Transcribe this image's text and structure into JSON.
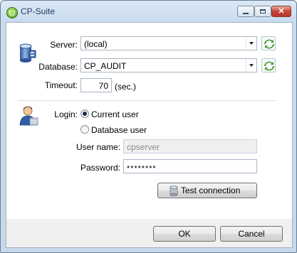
{
  "window": {
    "title": "CP-Suite",
    "controls": {
      "minimize": "minimize-icon",
      "maximize": "maximize-icon",
      "close": "close-icon"
    }
  },
  "connection": {
    "server_label": "Server:",
    "server_value": "(local)",
    "database_label": "Database:",
    "database_value": "CP_AUDIT",
    "timeout_label": "Timeout:",
    "timeout_value": "70",
    "timeout_unit": "(sec.)"
  },
  "login": {
    "label": "Login:",
    "options": [
      {
        "label": "Current user",
        "checked": true
      },
      {
        "label": "Database user",
        "checked": false
      }
    ],
    "username_label": "User name:",
    "username_value": "cpserver",
    "password_label": "Password:",
    "password_value": "••••••••",
    "test_button": "Test connection"
  },
  "footer": {
    "ok": "OK",
    "cancel": "Cancel"
  },
  "colors": {
    "title_text": "#1e395b",
    "refresh_green": "#3e9a22",
    "db_icon_blue": "#4a74b8"
  }
}
